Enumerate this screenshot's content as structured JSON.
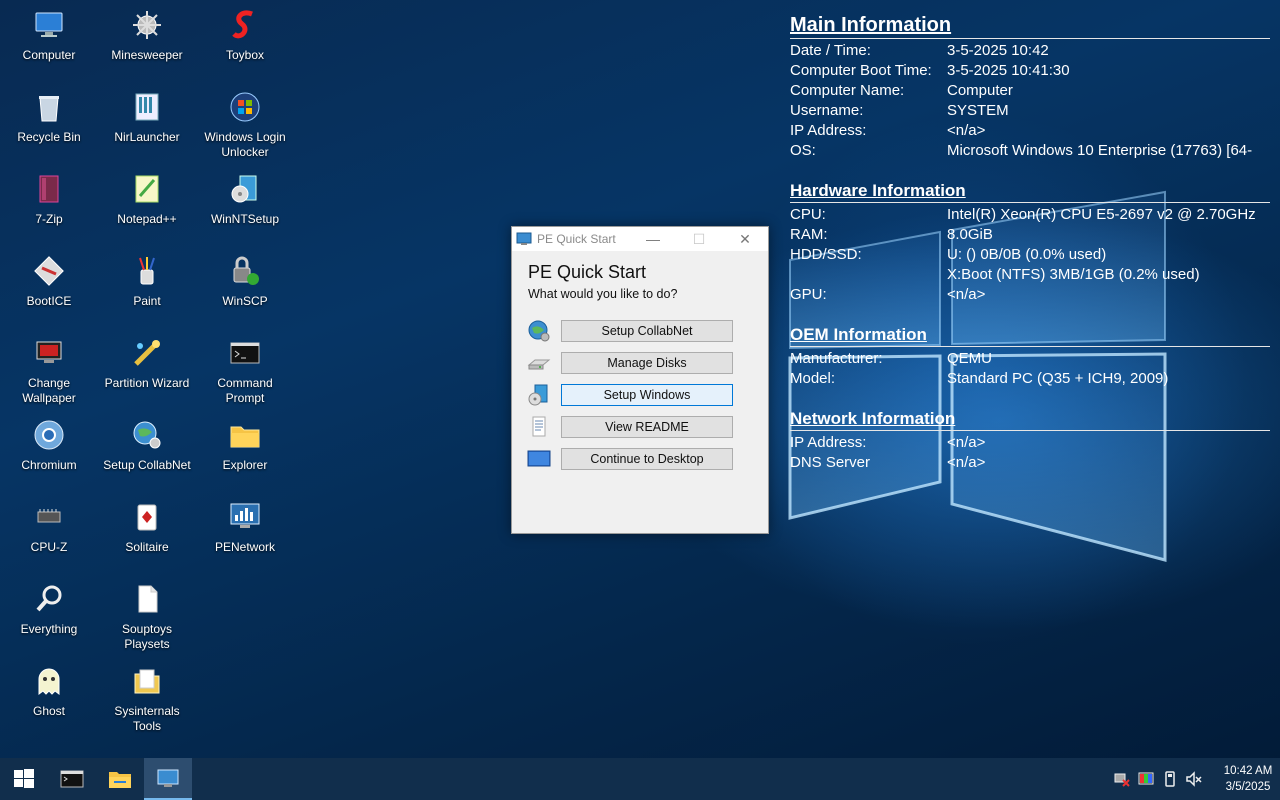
{
  "desktop": {
    "icons": [
      {
        "label": "Computer",
        "icon": "computer-icon"
      },
      {
        "label": "Minesweeper",
        "icon": "minesweeper-icon"
      },
      {
        "label": "Toybox",
        "icon": "toybox-icon"
      },
      {
        "label": "Recycle Bin",
        "icon": "recycle-bin-icon"
      },
      {
        "label": "NirLauncher",
        "icon": "nirlauncher-icon"
      },
      {
        "label": "Windows Login Unlocker",
        "icon": "windows-login-unlocker-icon"
      },
      {
        "label": "7-Zip",
        "icon": "7zip-icon"
      },
      {
        "label": "Notepad++",
        "icon": "notepadpp-icon"
      },
      {
        "label": "WinNTSetup",
        "icon": "winntsetup-icon"
      },
      {
        "label": "BootICE",
        "icon": "bootice-icon"
      },
      {
        "label": "Paint",
        "icon": "paint-icon"
      },
      {
        "label": "WinSCP",
        "icon": "winscp-icon"
      },
      {
        "label": "Change Wallpaper",
        "icon": "change-wallpaper-icon"
      },
      {
        "label": "Partition Wizard",
        "icon": "partition-wizard-icon"
      },
      {
        "label": "Command Prompt",
        "icon": "command-prompt-icon"
      },
      {
        "label": "Chromium",
        "icon": "chromium-icon"
      },
      {
        "label": "Setup CollabNet",
        "icon": "setup-collabnet-icon"
      },
      {
        "label": "Explorer",
        "icon": "explorer-icon"
      },
      {
        "label": "CPU-Z",
        "icon": "cpuz-icon"
      },
      {
        "label": "Solitaire",
        "icon": "solitaire-icon"
      },
      {
        "label": "PENetwork",
        "icon": "penetwork-icon"
      },
      {
        "label": "Everything",
        "icon": "everything-icon"
      },
      {
        "label": "Souptoys Playsets",
        "icon": "souptoys-icon"
      },
      {
        "label": "Ghost",
        "icon": "ghost-icon"
      },
      {
        "label": "Sysinternals Tools",
        "icon": "sysinternals-icon"
      }
    ]
  },
  "info": {
    "main": {
      "title": "Main Information",
      "rows": [
        {
          "k": "Date / Time:",
          "v": "3-5-2025 10:42"
        },
        {
          "k": "Computer Boot Time:",
          "v": "3-5-2025 10:41:30"
        },
        {
          "k": "Computer Name:",
          "v": "Computer"
        },
        {
          "k": "Username:",
          "v": "SYSTEM"
        },
        {
          "k": "IP Address:",
          "v": "<n/a>"
        },
        {
          "k": "OS:",
          "v": "Microsoft Windows 10 Enterprise (17763) [64-"
        }
      ]
    },
    "hardware": {
      "title": "Hardware Information",
      "rows": [
        {
          "k": "CPU:",
          "v": "Intel(R) Xeon(R) CPU E5-2697 v2 @ 2.70GHz"
        },
        {
          "k": "RAM:",
          "v": "8.0GiB"
        },
        {
          "k": "HDD/SSD:",
          "v": "U: () 0B/0B (0.0% used)"
        },
        {
          "k": "",
          "v": "X:Boot (NTFS) 3MB/1GB (0.2% used)"
        },
        {
          "k": "GPU:",
          "v": "<n/a>"
        }
      ]
    },
    "oem": {
      "title": "OEM Information",
      "rows": [
        {
          "k": "Manufacturer:",
          "v": "QEMU"
        },
        {
          "k": "Model:",
          "v": "Standard PC (Q35 + ICH9, 2009)"
        }
      ]
    },
    "network": {
      "title": "Network Information",
      "rows": [
        {
          "k": "IP Address:",
          "v": "<n/a>"
        },
        {
          "k": "DNS Server",
          "v": "<n/a>"
        }
      ]
    }
  },
  "dialog": {
    "title": "PE Quick Start",
    "heading": "PE Quick Start",
    "subheading": "What would you like to do?",
    "actions": [
      {
        "label": "Setup CollabNet",
        "icon": "globe-icon"
      },
      {
        "label": "Manage Disks",
        "icon": "disk-icon"
      },
      {
        "label": "Setup Windows",
        "icon": "windows-setup-icon"
      },
      {
        "label": "View README",
        "icon": "readme-icon"
      },
      {
        "label": "Continue to Desktop",
        "icon": "desktop-icon"
      }
    ],
    "focused_action": "Setup Windows"
  },
  "taskbar": {
    "buttons": [
      {
        "name": "start-button",
        "icon": "windows-logo-icon"
      },
      {
        "name": "taskbar-command-prompt",
        "icon": "command-prompt-icon"
      },
      {
        "name": "taskbar-explorer",
        "icon": "folder-icon"
      },
      {
        "name": "taskbar-pe-quick-start",
        "icon": "pe-quick-start-icon",
        "active": true
      }
    ],
    "tray": {
      "time": "10:42 AM",
      "date": "3/5/2025"
    }
  }
}
